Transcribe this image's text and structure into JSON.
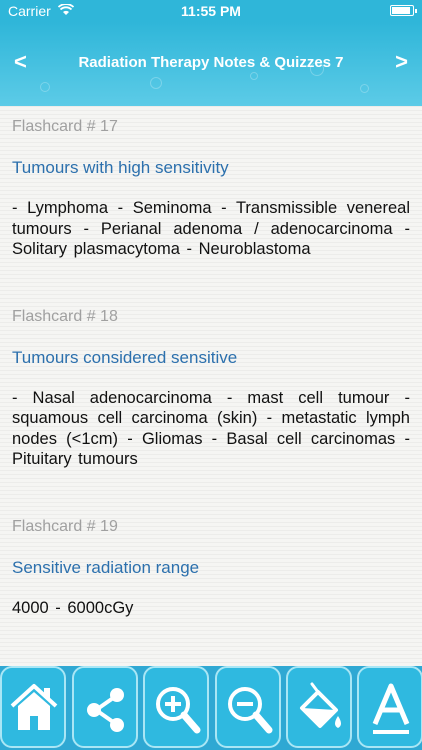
{
  "status": {
    "carrier": "Carrier",
    "time": "11:55 PM"
  },
  "nav": {
    "title": "Radiation Therapy Notes & Quizzes 7",
    "back": "<",
    "forward": ">"
  },
  "cards": [
    {
      "label": "Flashcard # 17",
      "heading": "Tumours with high sensitivity",
      "body": "- Lymphoma - Seminoma - Transmissible venereal tumours - Perianal adenoma / adenocarcinoma - Solitary plasmacytoma - Neuroblastoma"
    },
    {
      "label": "Flashcard # 18",
      "heading": "Tumours considered sensitive",
      "body": "- Nasal adenocarcinoma - mast cell tumour - squamous cell carcinoma (skin) - metastatic lymph nodes (<1cm) - Gliomas - Basal cell carcinomas - Pituitary tumours"
    },
    {
      "label": "Flashcard # 19",
      "heading": "Sensitive radiation range",
      "body": "4000 - 6000cGy"
    }
  ],
  "toolbar": [
    {
      "icon": "home-icon"
    },
    {
      "icon": "share-icon"
    },
    {
      "icon": "zoom-in-icon"
    },
    {
      "icon": "zoom-out-icon"
    },
    {
      "icon": "paint-bucket-icon"
    },
    {
      "icon": "font-icon"
    }
  ],
  "colors": {
    "primary": "#2fb6d9",
    "heading": "#2c70ad",
    "label": "#a0a0a0"
  }
}
